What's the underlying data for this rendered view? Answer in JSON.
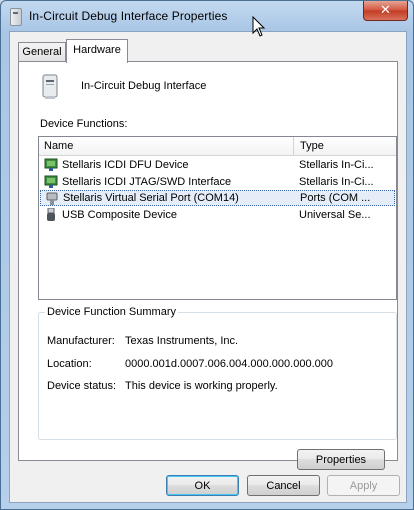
{
  "window": {
    "title": "In-Circuit Debug Interface Properties",
    "close_label": "✕"
  },
  "tabs": [
    {
      "label": "General"
    },
    {
      "label": "Hardware"
    }
  ],
  "device": {
    "name": "In-Circuit Debug Interface"
  },
  "functions": {
    "label": "Device Functions:",
    "columns": {
      "name": "Name",
      "type": "Type"
    },
    "rows": [
      {
        "name": "Stellaris ICDI DFU Device",
        "type": "Stellaris In-Ci...",
        "icon": "network-device-icon"
      },
      {
        "name": "Stellaris ICDI JTAG/SWD Interface",
        "type": "Stellaris In-Ci...",
        "icon": "network-device-icon"
      },
      {
        "name": "Stellaris Virtual Serial Port (COM14)",
        "type": "Ports (COM ...",
        "icon": "serial-port-icon",
        "selected": true
      },
      {
        "name": "USB Composite Device",
        "type": "Universal Se...",
        "icon": "usb-plug-icon"
      }
    ]
  },
  "summary": {
    "title": "Device Function Summary",
    "manufacturer_label": "Manufacturer:",
    "manufacturer": "Texas Instruments, Inc.",
    "location_label": "Location:",
    "location": "0000.001d.0007.006.004.000.000.000.000",
    "status_label": "Device status:",
    "status": "This device is working properly."
  },
  "buttons": {
    "properties": "Properties",
    "ok": "OK",
    "cancel": "Cancel",
    "apply": "Apply"
  },
  "colors": {
    "selection_background": "#e5eef8",
    "close_button": "#c23a22"
  }
}
